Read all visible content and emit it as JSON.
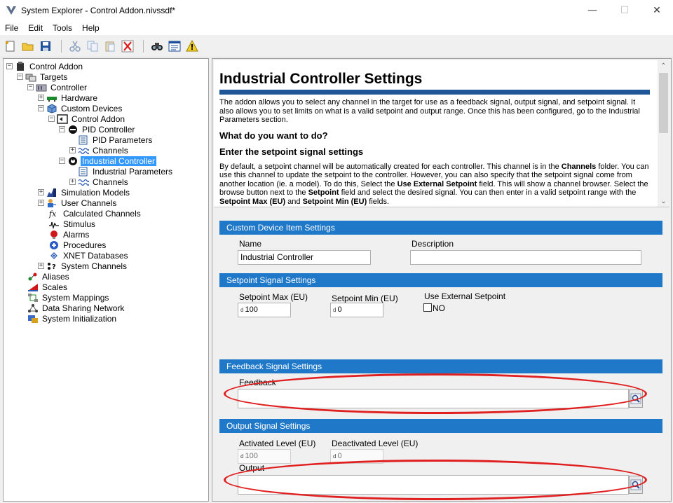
{
  "window": {
    "title": "System Explorer - Control Addon.nivssdf*",
    "controls": [
      "—",
      "☐",
      "✕"
    ]
  },
  "menu": [
    "File",
    "Edit",
    "Tools",
    "Help"
  ],
  "toolbar": {
    "buttons": [
      "new-icon",
      "open-icon",
      "save-icon",
      "cut-icon",
      "copy-icon",
      "paste-icon",
      "delete-icon",
      "find-icon",
      "properties-icon",
      "warning-icon"
    ]
  },
  "tree": [
    {
      "label": "Control Addon",
      "icon": "project-icon",
      "exp": "−"
    },
    {
      "label": "Targets",
      "icon": "targets-icon",
      "exp": "−"
    },
    {
      "label": "Controller",
      "icon": "controller-icon",
      "exp": "−"
    },
    {
      "label": "Hardware",
      "icon": "hardware-icon",
      "exp": "+"
    },
    {
      "label": "Custom Devices",
      "icon": "custom-devices-icon",
      "exp": "−"
    },
    {
      "label": "Control Addon",
      "icon": "addon-icon",
      "exp": "−"
    },
    {
      "label": "PID Controller",
      "icon": "pid-controller-icon",
      "exp": "−"
    },
    {
      "label": "PID Parameters",
      "icon": "parameters-icon",
      "exp": ""
    },
    {
      "label": "Channels",
      "icon": "channels-icon",
      "exp": "+"
    },
    {
      "label": "Industrial Controller",
      "icon": "industrial-controller-icon",
      "exp": "−",
      "selected": true
    },
    {
      "label": "Industrial Parameters",
      "icon": "parameters-icon",
      "exp": ""
    },
    {
      "label": "Channels",
      "icon": "channels-icon",
      "exp": "+"
    },
    {
      "label": "Simulation Models",
      "icon": "simulation-models-icon",
      "exp": "+"
    },
    {
      "label": "User Channels",
      "icon": "user-channels-icon",
      "exp": "+"
    },
    {
      "label": "Calculated Channels",
      "icon": "calculated-channels-icon",
      "exp": ""
    },
    {
      "label": "Stimulus",
      "icon": "stimulus-icon",
      "exp": ""
    },
    {
      "label": "Alarms",
      "icon": "alarms-icon",
      "exp": ""
    },
    {
      "label": "Procedures",
      "icon": "procedures-icon",
      "exp": ""
    },
    {
      "label": "XNET Databases",
      "icon": "xnet-databases-icon",
      "exp": ""
    },
    {
      "label": "System Channels",
      "icon": "system-channels-icon",
      "exp": "+"
    },
    {
      "label": "Aliases",
      "icon": "aliases-icon",
      "exp": ""
    },
    {
      "label": "Scales",
      "icon": "scales-icon",
      "exp": ""
    },
    {
      "label": "System Mappings",
      "icon": "system-mappings-icon",
      "exp": ""
    },
    {
      "label": "Data Sharing Network",
      "icon": "data-sharing-network-icon",
      "exp": ""
    },
    {
      "label": "System Initialization",
      "icon": "system-initialization-icon",
      "exp": ""
    }
  ],
  "help": {
    "title": "Industrial Controller Settings",
    "intro": "The addon allows you to select any channel in the target for use as a feedback signal, output signal, and setpoint signal. It also allows you to set limits on what is a valid setpoint and output range. Once this has been configured, go to the Industrial Parameters section.",
    "heading1": "What do you want to do?",
    "heading2": "Enter the setpoint signal settings",
    "para_parts": [
      "By default, a setpoint channel will be automatically created for each controller. This channel is in the ",
      "Channels",
      " folder. You can use this channel to update the setpoint to the controller. However, you can also specify that the setpoint signal come from another location (ie. a model). To do this, Select the ",
      "Use External Setpoint",
      " field. This will show a channel browser. Select the browse button next to the ",
      "Setpoint",
      " field and select the desired signal. You can then enter in a valid setpoint range with the ",
      "Setpoint Max (EU)",
      " and ",
      "Setpoint Min (EU)",
      " fields."
    ]
  },
  "custom_device": {
    "header": "Custom Device Item Settings",
    "name_label": "Name",
    "name_value": "Industrial Controller",
    "description_label": "Description",
    "description_value": ""
  },
  "setpoint": {
    "header": "Setpoint Signal Settings",
    "max_label": "Setpoint Max (EU)",
    "max_value": "100",
    "min_label": "Setpoint Min (EU)",
    "min_value": "0",
    "external_label": "Use External Setpoint",
    "external_value": "NO",
    "num_tag": "d"
  },
  "feedback": {
    "header": "Feedback Signal Settings",
    "label": "Feedback",
    "value": ""
  },
  "output": {
    "header": "Output Signal Settings",
    "activated_label": "Activated Level (EU)",
    "activated_value": "100",
    "deactivated_label": "Deactivated Level (EU)",
    "deactivated_value": "0",
    "label": "Output",
    "value": ""
  },
  "colors": {
    "section_header": "#1f78c8",
    "help_rule": "#1f5599",
    "selection": "#3399ff",
    "highlight": "#e02020"
  }
}
